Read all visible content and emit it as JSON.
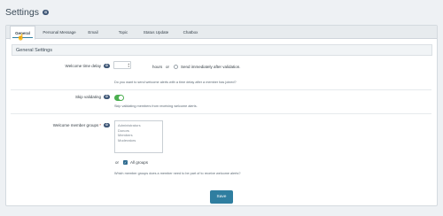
{
  "page": {
    "title": "Settings",
    "title_badge": "⊙"
  },
  "tabs": [
    "General",
    "Personal Message",
    "Email",
    "Topic",
    "Status Update",
    "Chatbox"
  ],
  "section": {
    "title": "General Settings"
  },
  "welcome_delay": {
    "label": "Welcome time delay",
    "badge": "⊙",
    "hours_text": "hours",
    "or_text": "or",
    "radio_label": "Send immediately after validation.",
    "explain": "Do you want to send welcome alerts with a time delay after a member has joined?"
  },
  "skip_validating": {
    "label": "Skip validating",
    "badge": "⊙",
    "explain": "Skip validating members from receiving welcome alerts."
  },
  "member_groups": {
    "label": "Welcome member groups",
    "required": "*",
    "badge": "⊙",
    "options": [
      "Administrators",
      "Donors",
      "Members",
      "Moderators"
    ],
    "or_text": "or",
    "all_groups_label": "All groups",
    "explain": "Which member groups does a member need to be part of to receive welcome alerts?"
  },
  "save_label": "Save"
}
